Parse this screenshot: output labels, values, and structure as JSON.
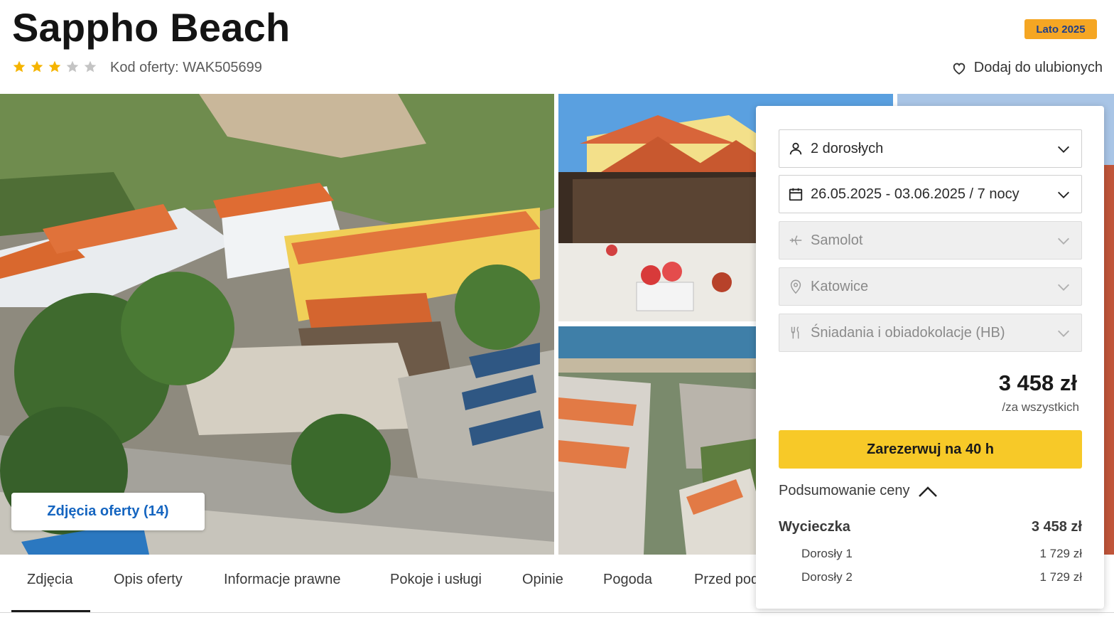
{
  "header": {
    "title": "Sappho Beach",
    "rating": 3,
    "max_rating": 5,
    "offer_code": "Kod oferty: WAK505699",
    "season_badge": "Lato 2025",
    "favorite_label": "Dodaj do ulubionych"
  },
  "gallery": {
    "photos_button_label": "Zdjęcia oferty (14)"
  },
  "tabs": [
    "Zdjęcia",
    "Opis oferty",
    "Informacje prawne",
    "Pokoje i usługi",
    "Opinie",
    "Pogoda",
    "Przed pod"
  ],
  "active_tab": 0,
  "booking": {
    "travelers": "2 dorosłych",
    "dates": "26.05.2025 - 03.06.2025 / 7 nocy",
    "transport": "Samolot",
    "departure": "Katowice",
    "board": "Śniadania i obiadokolacje (HB)",
    "price": "3 458 zł",
    "price_note": "/za wszystkich",
    "book_label": "Zarezerwuj na 40 h",
    "summary_label": "Podsumowanie ceny",
    "summary": {
      "trip_label": "Wycieczka",
      "trip_price": "3 458 zł",
      "adults": [
        {
          "label": "Dorosły 1",
          "price": "1 729 zł"
        },
        {
          "label": "Dorosły 2",
          "price": "1 729 zł"
        }
      ]
    }
  },
  "colors": {
    "star_filled": "#f5b400",
    "star_empty": "#c4c4c4",
    "badge_bg": "#f5a623",
    "badge_text": "#1e3f8a",
    "book_button": "#f7c928",
    "link_blue": "#1565c0"
  }
}
